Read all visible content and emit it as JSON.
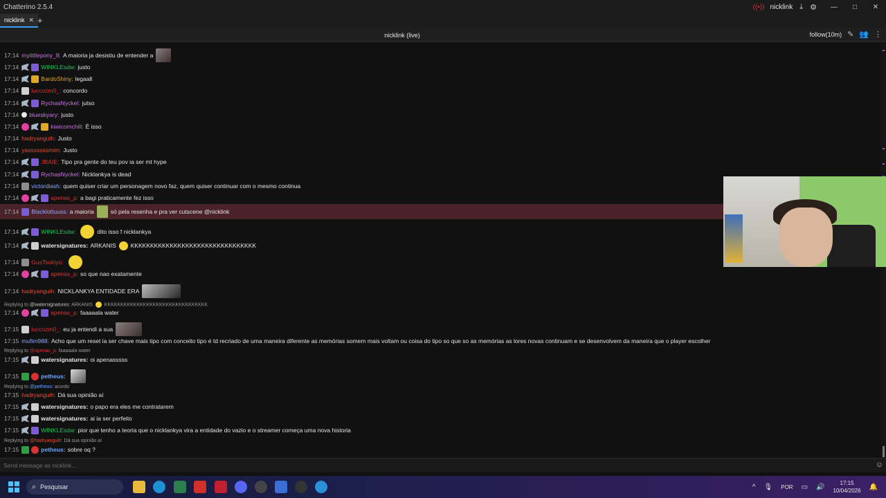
{
  "titlebar": {
    "app": "Chatterino 2.5.4",
    "user": "nicklink",
    "min": "—",
    "max": "□",
    "close": "✕"
  },
  "tabs": [
    {
      "label": "nicklink"
    }
  ],
  "split": {
    "title": "nicklink (live)",
    "follow": "follow(10m)"
  },
  "messages": [
    {
      "time": "17:14",
      "user": "mylittlepony_8:",
      "color": "#c678dd",
      "text": "A maioria ja desistiu de entender a"
    },
    {
      "time": "17:14",
      "user": "WINKLEsdw:",
      "color": "#22c55e",
      "text": "justo"
    },
    {
      "time": "17:14",
      "user": "BardoShiny:",
      "color": "#e0a624",
      "text": "legaall"
    },
    {
      "time": "17:14",
      "user": "luccozm0_:",
      "color": "#d93232",
      "text": "concordo"
    },
    {
      "time": "17:14",
      "user": "RychasNyckel:",
      "color": "#c678dd",
      "text": "jutso"
    },
    {
      "time": "17:14",
      "user": "blueskyary:",
      "color": "#c678dd",
      "text": "justo"
    },
    {
      "time": "17:14",
      "user": "kiwicomchili:",
      "color": "#c678dd",
      "text": "É isso"
    },
    {
      "time": "17:14",
      "user": "hadryanguih:",
      "color": "#e0503a",
      "text": "Justo"
    },
    {
      "time": "17:14",
      "user": "yasssssssmim:",
      "color": "#e0503a",
      "text": "Justo"
    },
    {
      "time": "17:14",
      "user": "JBAIE:",
      "color": "#d93232",
      "text": "Tipo pra gente do teu pov ia ser mt hype"
    },
    {
      "time": "17:14",
      "user": "RychasNyckel:",
      "color": "#c678dd",
      "text": "Nicklankya is dead"
    },
    {
      "time": "17:14",
      "user": "victordiash:",
      "color": "#8fa8ff",
      "text": "quem quiser criar um personagem novo faz, quem quiser continuar com o mesmo continua"
    },
    {
      "time": "17:14",
      "user": "apenas_p:",
      "color": "#d93232",
      "text": "a bagi praticamente fez isso"
    },
    {
      "time": "17:14",
      "user": "Blacklottuuss:",
      "color": "#8fa8ff",
      "text": "a maioria",
      "text2": "só pela resenha e pra ver cutscene @nicklink"
    },
    {
      "time": "17:14",
      "user": "WINKLEsdw:",
      "color": "#22c55e",
      "text": "dito isso f nicklankya"
    },
    {
      "time": "17:14",
      "user": "watersignatures:",
      "color": "#e6e6e6",
      "text": "ARKANIS",
      "text2": "KKKKKKKKKKKKKKKKKKKKKKKKKKKKKKKK"
    },
    {
      "time": "17:14",
      "user": "GusTsukiyo:",
      "color": "#d93232",
      "text": ""
    },
    {
      "time": "17:14",
      "user": "apenas_p:",
      "color": "#d93232",
      "text": "so que nao exatamente"
    },
    {
      "time": "17:14",
      "user": "hadryanguih:",
      "color": "#e0503a",
      "text": "NICKLANKYA ENTIDADE ERA"
    },
    {
      "time": "17:14",
      "user": "apenas_p:",
      "color": "#d93232",
      "text": "faaaaala water"
    },
    {
      "time": "17:15",
      "user": "luccozm0_:",
      "color": "#d93232",
      "text": "eu ja entendi a sua"
    },
    {
      "time": "17:15",
      "user": "mufim988:",
      "color": "#8fa8ff",
      "text": "Acho que um reset ia ser chave mais tipo com conceito tipo é td recriado de uma maneira diferente as memórias somem mais voltam ou coisa do tipo so que so as memórias as lores novas continuam e se desenvolvem da maneira que o player escolher"
    },
    {
      "time": "17:15",
      "user": "watersignatures:",
      "color": "#e6e6e6",
      "text": "oi apenasssss"
    },
    {
      "time": "17:15",
      "user": "petheus:",
      "color": "#6aa7ff",
      "text": ""
    },
    {
      "time": "17:15",
      "user": "hadryanguih:",
      "color": "#e0503a",
      "text": "Dá sua opinião aí"
    },
    {
      "time": "17:15",
      "user": "watersignatures:",
      "color": "#e6e6e6",
      "text": "o papo era eles me contratarem"
    },
    {
      "time": "17:15",
      "user": "watersignatures:",
      "color": "#e6e6e6",
      "text": "ai ia ser perfeito"
    },
    {
      "time": "17:15",
      "user": "WINKLEsdw:",
      "color": "#22c55e",
      "text": "pior que tenho a teoria que o nicklankya vira a entidade do vazio e o streamer começa uma nova historia"
    },
    {
      "time": "17:15",
      "user": "petheus:",
      "color": "#6aa7ff",
      "text": "sobre oq ?"
    }
  ],
  "replies": [
    {
      "prefix": "Replying to",
      "user": "@watersignatures:",
      "text": "ARKANIS",
      "text2": "KKKKKKKKKKKKKKKKKKKKKKKKKKKKKKKK"
    },
    {
      "prefix": "Replying to",
      "user": "@apenas_p:",
      "text": "faaaaala water"
    },
    {
      "prefix": "Replying to",
      "user": "@petheus:",
      "text": "acordo"
    },
    {
      "prefix": "Replying to",
      "user": "@hadryanguih:",
      "text": "Dá sua opinião aí"
    }
  ],
  "input": {
    "placeholder": "Send message as nicklink..."
  },
  "taskbar": {
    "search": "Pesquisar",
    "lang": "POR",
    "time": "17:15",
    "date": "10/04/2026"
  }
}
